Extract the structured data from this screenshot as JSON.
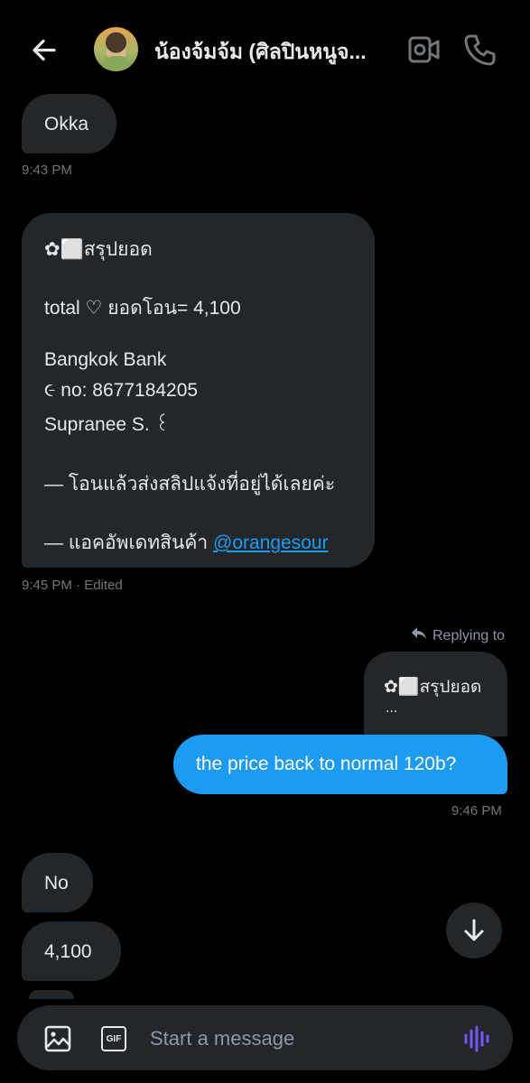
{
  "header": {
    "contact_name": "น้องจ้มจ้ม (ศิลปินหนูจ..."
  },
  "messages": {
    "okka": {
      "text": "Okka",
      "time": "9:43 PM"
    },
    "summary": {
      "title": "✿⬜สรุปยอด",
      "total": "total ♡ ยอดโอน= 4,100",
      "bank": "Bangkok Bank",
      "account": "૯ no: 8677184205",
      "holder": "Supranee S. ꒰",
      "note1": "— โอนแล้วส่งสลิปแจ้งที่อยู่ได้เลยค่ะ",
      "note2_prefix": "— แอคอัพเดทสินค้า ",
      "mention": "@orangesour",
      "meta": "9:45 PM · Edited"
    },
    "reply": {
      "label": "Replying to",
      "preview_title": "✿⬜สรุปยอด",
      "preview_more": "..."
    },
    "sent": {
      "text": "the price back to normal 120b?",
      "time": "9:46 PM"
    },
    "no": {
      "text": "No"
    },
    "amount": {
      "text": "4,100"
    }
  },
  "composer": {
    "placeholder": "Start a message",
    "gif_label": "GIF"
  },
  "colors": {
    "background": "#000000",
    "bubble_received": "#22272b",
    "bubble_sent": "#1d9bf0",
    "accent_voice": "#7856ff"
  }
}
